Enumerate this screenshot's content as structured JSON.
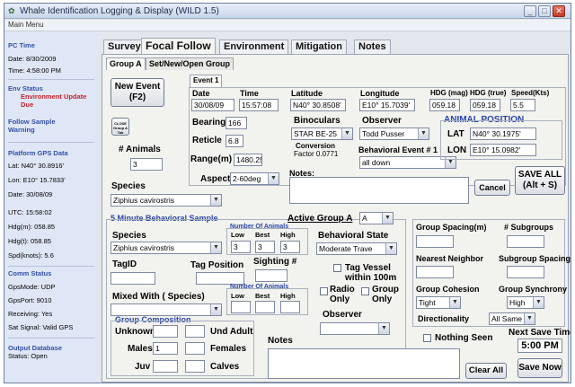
{
  "window": {
    "title": "Whale Identification Logging & Display (WILD 1.5)",
    "menu": "Main Menu"
  },
  "sidebar": {
    "pc_time_hd": "PC Time",
    "date": "Date: 8/30/2009",
    "time": "Time: 4:58:00 PM",
    "env_hd": "Env Status",
    "env_val": "Environment Update Due",
    "follow_hd": "Follow Sample Warning",
    "gps_hd": "Platform GPS Data",
    "lat": "Lat:   N40° 30.8916'",
    "lon": "Lon:   E10° 15.7833'",
    "gdate": "Date: 30/08/09",
    "utc": "UTC:  15:58:02",
    "hdgm": "Hdg(m): 058.85",
    "hdgt": "Hdg(t): 058.85",
    "spd": "Spd(knots): 5.6",
    "comm_hd": "Comm Status",
    "gpsmode": "GpsMode:  UDP",
    "gpsport": "GpsPort:    9010",
    "receiving": "Receiving:  Yes",
    "satsignal": "Sat Signal:  Valid GPS",
    "output_hd": "Output Database",
    "status": "Status:    Open"
  },
  "tabs": [
    "Survey",
    "Focal Follow",
    "Environment",
    "Mitigation",
    "Notes"
  ],
  "subtabs": [
    "Group A",
    "Set/New/Open Group"
  ],
  "event": {
    "new_event": "New Event",
    "new_event_key": "(F2)",
    "event_tab": "Event 1",
    "date_lbl": "Date",
    "date_val": "30/08/09",
    "time_lbl": "Time",
    "time_val": "15:57:08",
    "lat_lbl": "Latitude",
    "lat_val": "N40° 30.8508'",
    "lon_lbl": "Longitude",
    "lon_val": "E10° 15.7039'",
    "hdgm_lbl": "HDG (mag)",
    "hdgm_val": "059.18",
    "hdgt_lbl": "HDG (true)",
    "hdgt_val": "059.18",
    "spd_lbl": "Speed(Kts)",
    "spd_val": "5.5",
    "close_btn": "CLOSE Group A Tab",
    "bearing_lbl": "Bearing",
    "bearing_val": "166",
    "reticle_lbl": "Reticle",
    "reticle_val": "6.8",
    "range_lbl": "Range(m)",
    "range_val": "1480.25",
    "aspect_lbl": "Aspect",
    "aspect_val": "2-60deg",
    "animals_lbl": "# Animals",
    "animals_val": "3",
    "species_lbl": "Species",
    "species_val": "Ziphius cavirostris",
    "binoc_lbl": "Binoculars",
    "binoc_val": "STAR BE-25",
    "conv_lbl": "Conversion",
    "conv_val": "Factor 0.0771",
    "observer_lbl": "Observer",
    "observer_val": "Todd Pusser",
    "behav_lbl": "Behavioral Event # 1",
    "behav_val": "all down",
    "notes_lbl": "Notes:",
    "animal_pos": "ANIMAL POSITION",
    "apos_lat_lbl": "LAT",
    "apos_lat_val": "N40° 30.1975'",
    "apos_lon_lbl": "LON",
    "apos_lon_val": "E10° 15.0982'",
    "cancel": "Cancel",
    "save_all": "SAVE ALL",
    "save_all_key": "(Alt + S)"
  },
  "sample": {
    "title": "5 Minute Behavioral Sample",
    "active_lbl": "Active Group A",
    "active_val": "A",
    "species_lbl": "Species",
    "species_val": "Ziphius cavirostris",
    "num_animals": "Number Of Animals",
    "low": "Low",
    "best": "Best",
    "high": "High",
    "low_val": "3",
    "best_val": "3",
    "high_val": "3",
    "behav_state_lbl": "Behavioral State",
    "behav_state_val": "Moderate Trave",
    "tagid": "TagID",
    "tagpos": "Tag Position",
    "sighting": "Sighting #",
    "tag_vessel": "Tag Vessel within 100m",
    "mixed": "Mixed With ( Species)",
    "num_animals2": "Number Of Animals",
    "low2": "Low",
    "best2": "Best",
    "high2": "High",
    "radio_only": "Radio Only",
    "group_only": "Group Only",
    "observer": "Observer",
    "comp_title": "Group Composition",
    "unknown": "Unknown",
    "und_adult": "Und Adult",
    "males": "Males",
    "males_val": "1",
    "females": "Females",
    "juv": "Juv",
    "calves": "Calves",
    "notes": "Notes",
    "spacing": "Group Spacing(m)",
    "subgroups": "# Subgroups",
    "nearest": "Nearest Neighbor",
    "sub_spacing": "Subgroup Spacing",
    "cohesion": "Group Cohesion",
    "cohesion_val": "Tight",
    "synchrony": "Group Synchrony",
    "synchrony_val": "High",
    "direction": "Directionality",
    "direction_val": "All Same",
    "nothing_seen": "Nothing Seen",
    "next_save_lbl": "Next Save Time",
    "next_save_val": "5:00 PM",
    "clear_all": "Clear All",
    "save_now": "Save Now"
  }
}
